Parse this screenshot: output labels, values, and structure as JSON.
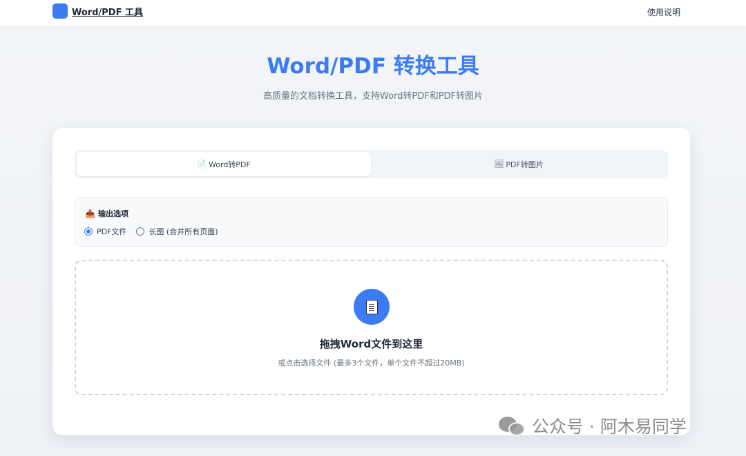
{
  "header": {
    "brand": "Word/PDF 工具",
    "help": "使用说明"
  },
  "hero": {
    "title": "Word/PDF 转换工具",
    "subtitle": "高质量的文档转换工具，支持Word转PDF和PDF转图片"
  },
  "tabs": [
    {
      "icon": "📄",
      "label": "Word转PDF",
      "active": true
    },
    {
      "icon": "🖼",
      "label": "PDF转图片",
      "active": false
    }
  ],
  "options": {
    "icon": "📤",
    "title": "输出选项",
    "radios": [
      {
        "label": "PDF文件",
        "checked": true
      },
      {
        "label": "长图 (合并所有页面)",
        "checked": false
      }
    ]
  },
  "dropzone": {
    "title": "拖拽Word文件到这里",
    "hint": "或点击选择文件 (最多3个文件，单个文件不超过20MB)"
  },
  "watermark": {
    "text": "公众号 · 阿木易同学"
  },
  "colors": {
    "accent": "#3b7cf5"
  }
}
